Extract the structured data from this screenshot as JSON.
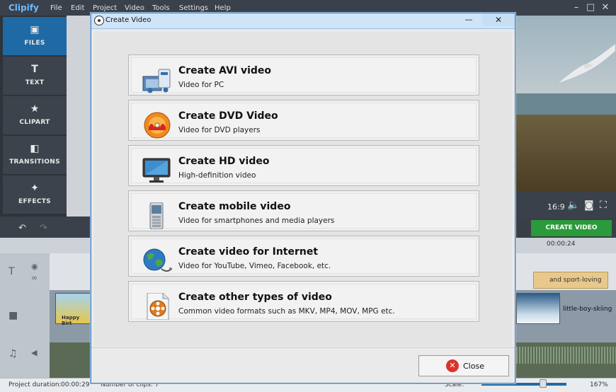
{
  "app": {
    "logo": "Clipify",
    "menu": [
      "File",
      "Edit",
      "Project",
      "Video",
      "Tools",
      "Settings",
      "Help"
    ]
  },
  "sidebar": {
    "tabs": [
      {
        "label": "FILES",
        "icon": "image-icon"
      },
      {
        "label": "TEXT",
        "icon": "text-icon"
      },
      {
        "label": "CLIPART",
        "icon": "star-icon"
      },
      {
        "label": "TRANSITIONS",
        "icon": "transitions-icon"
      },
      {
        "label": "EFFECTS",
        "icon": "magic-wand-icon"
      }
    ]
  },
  "preview": {
    "aspect_ratio": "16:9"
  },
  "create_video_button": "CREATE VIDEO",
  "timeline": {
    "time_marker": "00:00:24",
    "left_clip_text": "Happy Birt",
    "text_clip": "and sport-loving",
    "right_clip": "little-boy-skiing"
  },
  "status": {
    "duration_label": "Project duration:",
    "duration_value": "00:00:29",
    "clips_label": "Number of clips: 7",
    "scale_label": "Scale:",
    "zoom": "167%"
  },
  "dialog": {
    "title": "Create Video",
    "options": [
      {
        "title": "Create AVI video",
        "subtitle": "Video for PC",
        "icon": "avi-film-icon"
      },
      {
        "title": "Create DVD Video",
        "subtitle": "Video for DVD players",
        "icon": "dvd-disc-icon"
      },
      {
        "title": "Create HD video",
        "subtitle": "High-definition video",
        "icon": "monitor-icon"
      },
      {
        "title": "Create mobile video",
        "subtitle": "Video for smartphones and media players",
        "icon": "mobile-phone-icon"
      },
      {
        "title": "Create video for Internet",
        "subtitle": "Video for YouTube, Vimeo, Facebook, etc.",
        "icon": "globe-icon"
      },
      {
        "title": "Create other types of video",
        "subtitle": "Common video formats such as MKV, MP4, MOV, MPG etc.",
        "icon": "film-reel-document-icon"
      }
    ],
    "close_label": "Close"
  }
}
